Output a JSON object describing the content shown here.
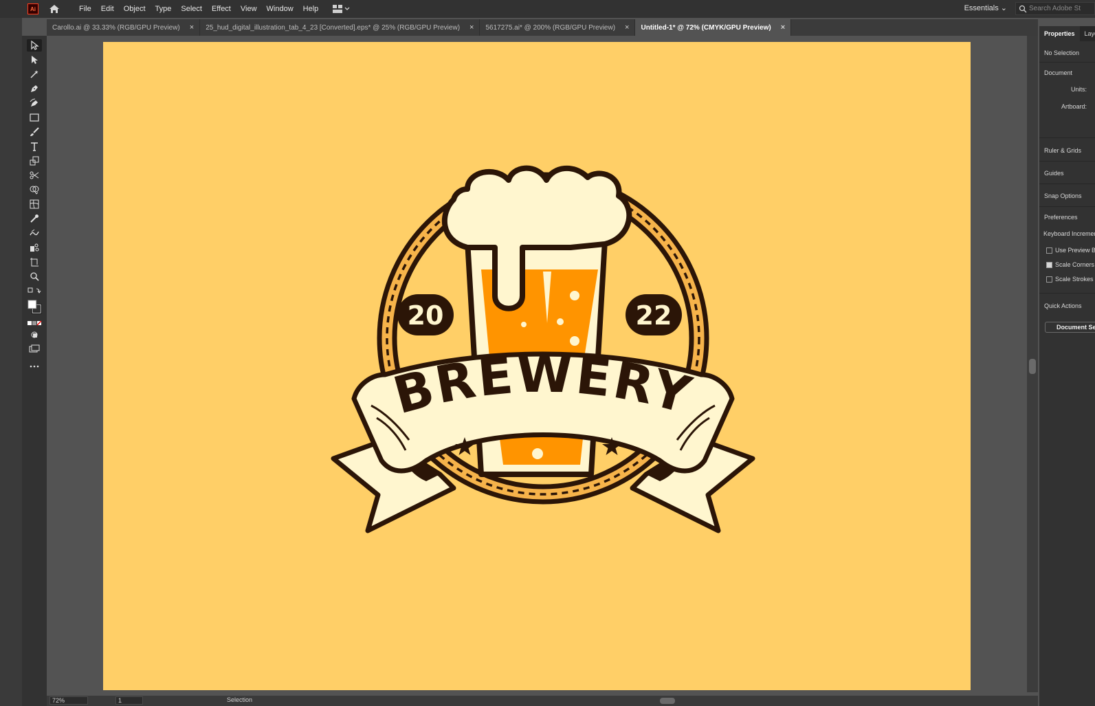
{
  "app": {
    "logo": "Ai",
    "home_icon": "home-icon"
  },
  "menu": [
    "File",
    "Edit",
    "Object",
    "Type",
    "Select",
    "Effect",
    "View",
    "Window",
    "Help"
  ],
  "workspace": {
    "label": "Essentials",
    "search_placeholder": "Search Adobe St"
  },
  "tabs": [
    {
      "label": "Carollo.ai @ 33.33% (RGB/GPU Preview)",
      "active": false
    },
    {
      "label": "25_hud_digital_illustration_tab_4_23 [Converted].eps* @ 25% (RGB/GPU Preview)",
      "active": false
    },
    {
      "label": "5617275.ai* @ 200% (RGB/GPU Preview)",
      "active": false
    },
    {
      "label": "Untitled-1* @ 72% (CMYK/GPU Preview)",
      "active": true
    }
  ],
  "tools": [
    "selection-tool-icon",
    "direct-selection-tool-icon",
    "magic-wand-tool-icon",
    "pen-tool-icon",
    "curvature-tool-icon",
    "rectangle-tool-icon",
    "paintbrush-tool-icon",
    "type-tool-icon",
    "scale-tool-icon",
    "scissors-tool-icon",
    "shape-builder-tool-icon",
    "mesh-tool-icon",
    "eyedropper-tool-icon",
    "blend-tool-icon",
    "symbol-sprayer-tool-icon",
    "artboard-tool-icon",
    "zoom-tool-icon"
  ],
  "artwork": {
    "year_left": "20",
    "year_right": "22",
    "banner_text": "BREWERY",
    "colors": {
      "artboard": "#ffcf67",
      "outline": "#2b1507",
      "cream": "#fff6cf",
      "beer": "#ff9400",
      "ring": "#f6b34a"
    }
  },
  "status": {
    "zoom": "72%",
    "page": "1",
    "tool": "Selection"
  },
  "properties_panel": {
    "tabs": [
      "Properties",
      "Laye"
    ],
    "no_selection": "No Selection",
    "document": "Document",
    "units_label": "Units:",
    "artboard_label": "Artboard:",
    "ruler_grids": "Ruler & Grids",
    "guides": "Guides",
    "snap_options": "Snap Options",
    "preferences": "Preferences",
    "keyboard_increment": "Keyboard Incremen",
    "checkboxes": [
      {
        "label": "Use Preview B",
        "checked": false
      },
      {
        "label": "Scale Corners",
        "checked": true
      },
      {
        "label": "Scale Strokes &",
        "checked": false
      }
    ],
    "quick_actions": "Quick Actions",
    "document_setup": "Document Set"
  }
}
